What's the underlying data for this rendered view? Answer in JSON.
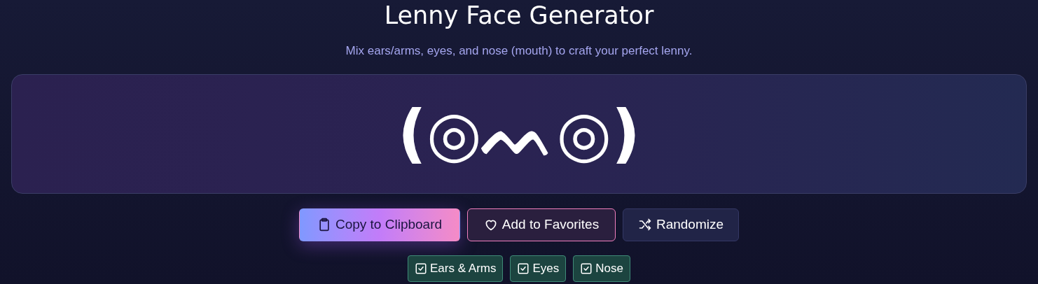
{
  "title": "Lenny Face Generator",
  "subtitle": "Mix ears/arms, eyes, and nose (mouth) to craft your perfect lenny.",
  "preview": {
    "face": "(◎ᨓ◎)"
  },
  "buttons": [
    {
      "label": "Copy to Clipboard",
      "kind": "copy"
    },
    {
      "label": "Add to Favorites",
      "kind": "favorite"
    },
    {
      "label": "Randomize",
      "kind": "random"
    }
  ],
  "toggles": [
    {
      "label": "Ears & Arms",
      "checked": true
    },
    {
      "label": "Eyes",
      "checked": true
    },
    {
      "label": "Nose",
      "checked": true
    }
  ]
}
